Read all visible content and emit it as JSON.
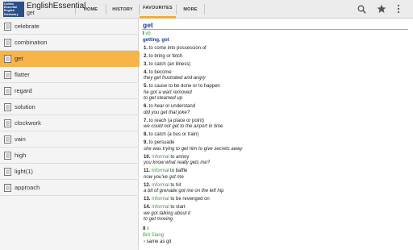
{
  "app": {
    "logo_text": "Collins Essential English Dictionary",
    "title": "EnglishEssential",
    "subtitle": "get"
  },
  "tabs": [
    {
      "label": "HOME"
    },
    {
      "label": "HISTORY"
    },
    {
      "label": "FAVOURITES",
      "active": true
    },
    {
      "label": "MORE"
    }
  ],
  "actions": [
    {
      "icon": "search-icon"
    },
    {
      "icon": "star-icon"
    },
    {
      "icon": "overflow-menu-icon"
    }
  ],
  "colors": {
    "accent": "#f7b547",
    "headword": "#1d3d8f",
    "label_green": "#3d9d3d"
  },
  "favourites": [
    {
      "word": "celebrate"
    },
    {
      "word": "combination"
    },
    {
      "word": "get",
      "selected": true
    },
    {
      "word": "flatter"
    },
    {
      "word": "regard"
    },
    {
      "word": "solution"
    },
    {
      "word": "clockwork"
    },
    {
      "word": "vain"
    },
    {
      "word": "high"
    },
    {
      "word": "light(1)"
    },
    {
      "word": "approach"
    }
  ],
  "entry": {
    "headword": "get",
    "pos1_num": "I",
    "pos1": "vb",
    "forms": "getting, got",
    "senses": [
      {
        "num": "1.",
        "text": " to come into possession of",
        "label": "",
        "examples": []
      },
      {
        "num": "2.",
        "text": " to bring or fetch",
        "label": "",
        "examples": []
      },
      {
        "num": "3.",
        "text": " to catch (an illness)",
        "label": "",
        "examples": []
      },
      {
        "num": "4.",
        "text": " to become",
        "label": "",
        "examples": [
          "they get frustrated and angry"
        ]
      },
      {
        "num": "5.",
        "text": " to cause to be done or to happen",
        "label": "",
        "examples": [
          "he got a wart removed",
          "to get steamed up"
        ]
      },
      {
        "num": "6.",
        "text": " to hear or understand",
        "label": "",
        "examples": [
          "did you get that joke?"
        ]
      },
      {
        "num": "7.",
        "text": " to reach (a place or point)",
        "label": "",
        "examples": [
          "we could not get to the airport in time"
        ]
      },
      {
        "num": "8.",
        "text": " to catch (a bus or train)",
        "label": "",
        "examples": []
      },
      {
        "num": "9.",
        "text": " to persuade",
        "label": "",
        "examples": [
          "she was trying to get him to give secrets away"
        ]
      },
      {
        "num": "10.",
        "text": " to annoy",
        "label": "Informal",
        "examples": [
          "you know what really gets me?"
        ]
      },
      {
        "num": "11.",
        "text": " to baffle",
        "label": "Informal",
        "examples": [
          "now you've got me"
        ]
      },
      {
        "num": "12.",
        "text": " to hit",
        "label": "Informal",
        "examples": [
          "a bit of grenade got me on the left hip"
        ]
      },
      {
        "num": "13.",
        "text": " to be revenged on",
        "label": "Informal",
        "examples": []
      },
      {
        "num": "14.",
        "text": " to start",
        "label": "Informal",
        "examples": [
          "we got talking about it",
          "to get moving"
        ]
      }
    ],
    "pos2_num": "II",
    "pos2": "n",
    "pos2_label": "Brit Slang",
    "pos2_text": "same as git"
  }
}
